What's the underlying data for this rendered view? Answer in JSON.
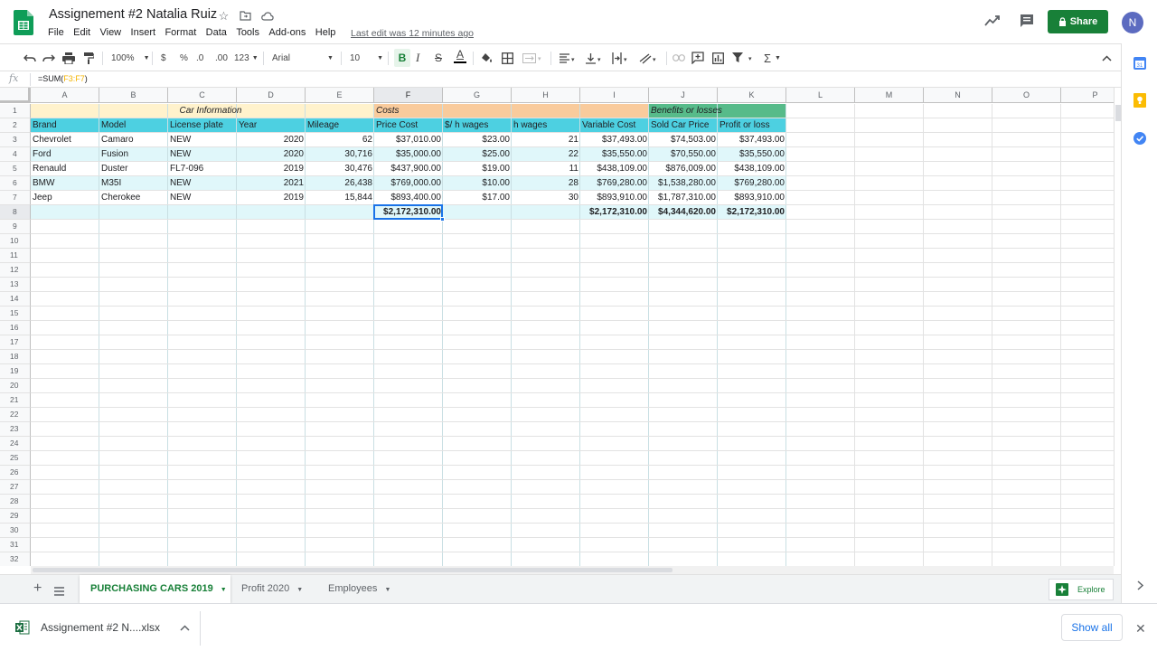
{
  "title": "Assignement #2 Natalia Ruiz",
  "menus": [
    "File",
    "Edit",
    "View",
    "Insert",
    "Format",
    "Data",
    "Tools",
    "Add-ons",
    "Help"
  ],
  "last_edit": "Last edit was 12 minutes ago",
  "share_label": "Share",
  "avatar_initial": "N",
  "toolbar": {
    "zoom": "100%",
    "currency": "$",
    "percent": "%",
    "dec_decrease": ".0",
    "dec_increase": ".00",
    "number_format": "123",
    "font": "Arial",
    "font_size": "10",
    "bold": "B",
    "italic": "I",
    "strike": "S",
    "text_color": "A",
    "sum": "Σ"
  },
  "formula_bar": {
    "fx": "fx",
    "prefix": "=SUM(",
    "range": "F3:F7",
    "suffix": ")"
  },
  "columns": [
    "A",
    "B",
    "C",
    "D",
    "E",
    "F",
    "G",
    "H",
    "I",
    "J",
    "K",
    "L",
    "M",
    "N",
    "O",
    "P"
  ],
  "rows": [
    "1",
    "2",
    "3",
    "4",
    "5",
    "6",
    "7",
    "8",
    "9",
    "10",
    "11",
    "12",
    "13",
    "14",
    "15",
    "16",
    "17",
    "18",
    "19",
    "20",
    "21",
    "22",
    "23",
    "24",
    "25",
    "26",
    "27",
    "28",
    "29",
    "30",
    "31",
    "32"
  ],
  "sheet": {
    "group_headers": {
      "car_info": "Car Information",
      "costs": "Costs",
      "benefits": "Benefits or losses"
    },
    "headers": [
      "Brand",
      "Model",
      "License plate",
      "Year",
      "Mileage",
      "Price Cost",
      "$/ h wages",
      "h wages",
      "Variable Cost",
      "Sold Car Price",
      "Profit or loss"
    ],
    "data": [
      [
        "Chevrolet",
        "Camaro",
        "NEW",
        "2020",
        "62",
        "$37,010.00",
        "$23.00",
        "21",
        "$37,493.00",
        "$74,503.00",
        "$37,493.00"
      ],
      [
        "Ford",
        "Fusion",
        "NEW",
        "2020",
        "30,716",
        "$35,000.00",
        "$25.00",
        "22",
        "$35,550.00",
        "$70,550.00",
        "$35,550.00"
      ],
      [
        "Renauld",
        "Duster",
        "FL7-096",
        "2019",
        "30,476",
        "$437,900.00",
        "$19.00",
        "11",
        "$438,109.00",
        "$876,009.00",
        "$438,109.00"
      ],
      [
        "BMW",
        "M35I",
        "NEW",
        "2021",
        "26,438",
        "$769,000.00",
        "$10.00",
        "28",
        "$769,280.00",
        "$1,538,280.00",
        "$769,280.00"
      ],
      [
        "Jeep",
        "Cherokee",
        "NEW",
        "2019",
        "15,844",
        "$893,400.00",
        "$17.00",
        "30",
        "$893,910.00",
        "$1,787,310.00",
        "$893,910.00"
      ]
    ],
    "totals": {
      "price_cost": "$2,172,310.00",
      "variable_cost": "$2,172,310.00",
      "sold_car_price": "$4,344,620.00",
      "profit_or_loss": "$2,172,310.00"
    },
    "colors": {
      "car_info_header": "#fff2cc",
      "costs_header": "#f9cb9c",
      "benefits_header": "#57bb8a",
      "column_header_row": "#4dd0e1",
      "band_light": "#e0f7fa",
      "band_white": "#ffffff"
    }
  },
  "tabs": [
    {
      "label": "PURCHASING CARS 2019",
      "active": true
    },
    {
      "label": "Profit 2020",
      "active": false
    },
    {
      "label": "Employees",
      "active": false
    }
  ],
  "explore_label": "Explore",
  "download": {
    "filename": "Assignement #2 N....xlsx",
    "show_all": "Show all"
  }
}
